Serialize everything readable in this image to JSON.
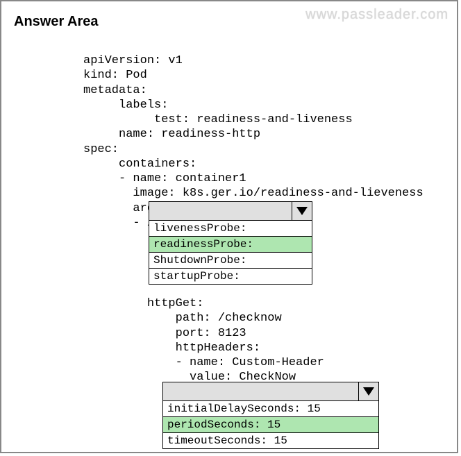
{
  "title": "Answer Area",
  "watermark": "www.passleader.com",
  "yaml1": "apiVersion: v1\nkind: Pod\nmetadata:\n     labels:\n          test: readiness-and-liveness\n     name: readiness-http\nspec:\n     containers:\n     - name: container1\n       image: k8s.ger.io/readiness-and-lieveness\n       args:\n       - /server",
  "dropdown1": {
    "options": [
      "livenessProbe:",
      "readinessProbe:",
      "ShutdownProbe:",
      "startupProbe:"
    ],
    "selected_index": 1
  },
  "yaml2": "         httpGet:\n             path: /checknow\n             port: 8123\n             httpHeaders:\n             - name: Custom-Header\n               value: CheckNow",
  "dropdown2": {
    "options": [
      "initialDelaySeconds: 15",
      "periodSeconds: 15",
      "timeoutSeconds: 15"
    ],
    "selected_index": 1
  }
}
